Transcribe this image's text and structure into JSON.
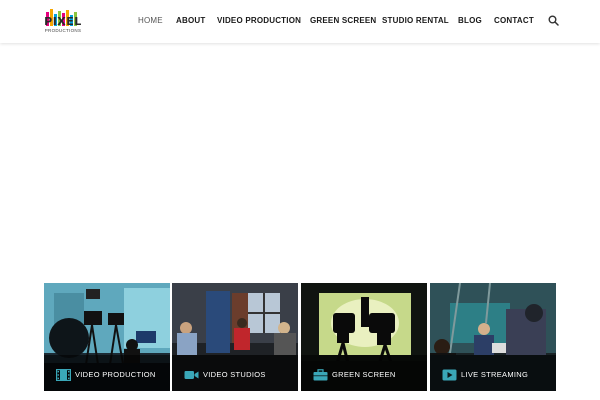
{
  "brand": {
    "logo_word": "PIXEL",
    "logo_sub": "PRODUCTIONS",
    "bar_colors": [
      "#e6007e",
      "#f7a600",
      "#00a3e0",
      "#8cc63f",
      "#e6007e",
      "#f7a600",
      "#00a3e0",
      "#8cc63f"
    ]
  },
  "nav": {
    "items": [
      {
        "label": "HOME",
        "active": true
      },
      {
        "label": "ABOUT"
      },
      {
        "label": "VIDEO PRODUCTION"
      },
      {
        "label": "GREEN SCREEN"
      },
      {
        "label": "STUDIO RENTAL"
      },
      {
        "label": "BLOG"
      },
      {
        "label": "CONTACT"
      }
    ],
    "search_icon": "search-icon"
  },
  "tiles": [
    {
      "label": "VIDEO PRODUCTION",
      "icon": "film-icon",
      "accent": "#3aa7b8"
    },
    {
      "label": "VIDEO STUDIOS",
      "icon": "video-camera-icon",
      "accent": "#3aa7b8"
    },
    {
      "label": "GREEN SCREEN",
      "icon": "briefcase-icon",
      "accent": "#3aa7b8"
    },
    {
      "label": "LIVE STREAMING",
      "icon": "play-icon",
      "accent": "#3aa7b8"
    }
  ]
}
